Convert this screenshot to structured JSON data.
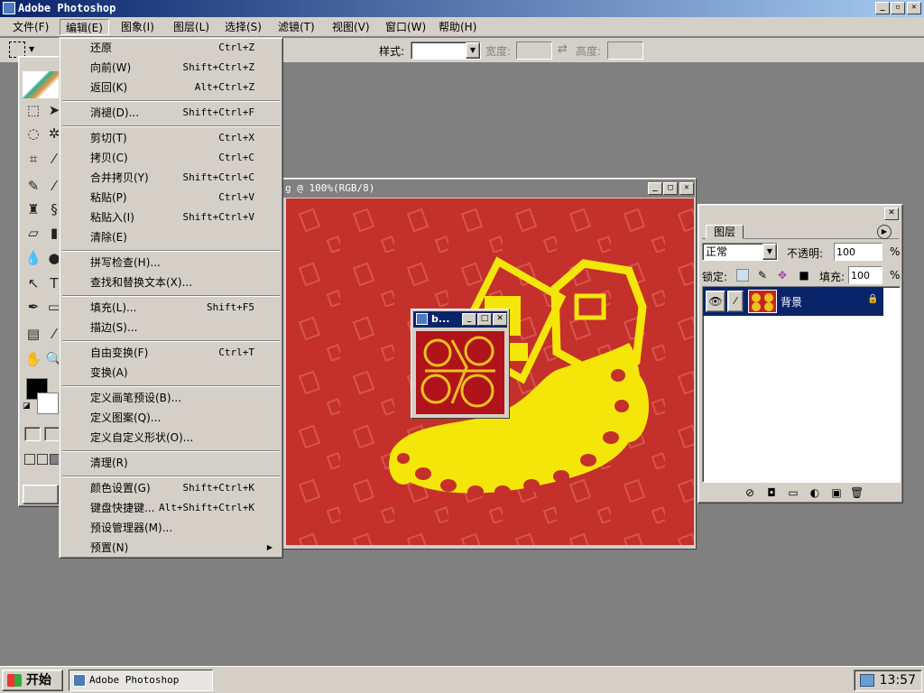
{
  "window": {
    "title": "Adobe Photoshop",
    "min": "_",
    "max": "▫",
    "close": "✕"
  },
  "menubar": [
    "文件(F)",
    "编辑(E)",
    "图象(I)",
    "图层(L)",
    "选择(S)",
    "滤镜(T)",
    "视图(V)",
    "窗口(W)",
    "帮助(H)"
  ],
  "options": {
    "style_label": "样式:",
    "style_value": "",
    "width_label": "宽度:",
    "width_value": "",
    "height_label": "高度:",
    "height_value": ""
  },
  "edit_menu": {
    "items": [
      {
        "label": "还原",
        "shortcut": "Ctrl+Z"
      },
      {
        "label": "向前(W)",
        "shortcut": "Shift+Ctrl+Z"
      },
      {
        "label": "返回(K)",
        "shortcut": "Alt+Ctrl+Z"
      },
      {
        "label": "消褪(D)...",
        "shortcut": "Shift+Ctrl+F"
      },
      {
        "label": "剪切(T)",
        "shortcut": "Ctrl+X"
      },
      {
        "label": "拷贝(C)",
        "shortcut": "Ctrl+C"
      },
      {
        "label": "合并拷贝(Y)",
        "shortcut": "Shift+Ctrl+C"
      },
      {
        "label": "粘贴(P)",
        "shortcut": "Ctrl+V"
      },
      {
        "label": "粘贴入(I)",
        "shortcut": "Shift+Ctrl+V"
      },
      {
        "label": "清除(E)",
        "shortcut": ""
      },
      {
        "label": "拼写检查(H)...",
        "shortcut": ""
      },
      {
        "label": "查找和替换文本(X)...",
        "shortcut": ""
      },
      {
        "label": "填充(L)...",
        "shortcut": "Shift+F5"
      },
      {
        "label": "描边(S)...",
        "shortcut": ""
      },
      {
        "label": "自由变换(F)",
        "shortcut": "Ctrl+T"
      },
      {
        "label": "变换(A)",
        "shortcut": ""
      },
      {
        "label": "定义画笔预设(B)...",
        "shortcut": ""
      },
      {
        "label": "定义图案(Q)...",
        "shortcut": ""
      },
      {
        "label": "定义自定义形状(O)...",
        "shortcut": ""
      },
      {
        "label": "清理(R)",
        "shortcut": ""
      },
      {
        "label": "颜色设置(G)",
        "shortcut": "Shift+Ctrl+K"
      },
      {
        "label": "键盘快捷键...",
        "shortcut": "Alt+Shift+Ctrl+K"
      },
      {
        "label": "预设管理器(M)...",
        "shortcut": ""
      },
      {
        "label": "预置(N)",
        "shortcut": "",
        "submenu": "▶"
      }
    ]
  },
  "document": {
    "title": "g @ 100%(RGB/8)",
    "min": "_",
    "max": "□",
    "close": "✕"
  },
  "mini_window": {
    "title": "b...",
    "min": "_",
    "max": "□",
    "close": "✕"
  },
  "layers_panel": {
    "close": "✕",
    "tab": "图层",
    "blend_mode": "正常",
    "opacity_label": "不透明:",
    "opacity_value": "100",
    "percent": "%",
    "lock_label": "锁定:",
    "fill_label": "填充:",
    "fill_value": "100",
    "layer_name": "背景",
    "lock_icon": "🔒",
    "footer_icons": [
      "⊘",
      "◘",
      "▭",
      "◐",
      "▣",
      "🗑"
    ]
  },
  "taskbar": {
    "start": "开始",
    "task": "Adobe Photoshop",
    "time": "13:57"
  },
  "colors": {
    "canvas_red": "#c4302b",
    "artwork_yellow": "#f5e60a",
    "titlebar_blue": "#0a246a",
    "layer_selected": "#0a246a"
  }
}
